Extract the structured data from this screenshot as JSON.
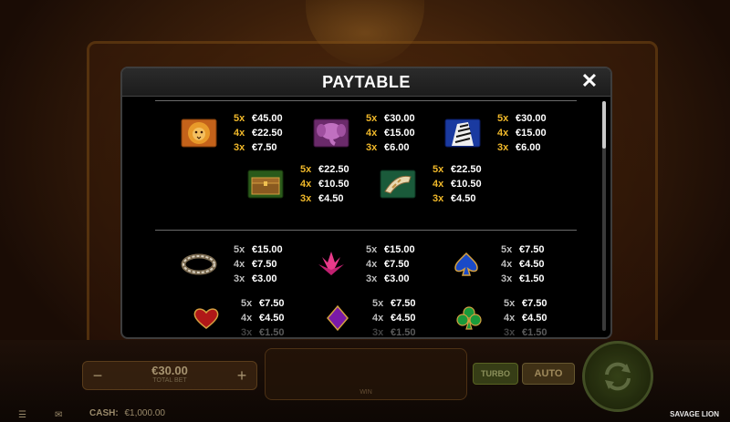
{
  "modal": {
    "title": "PAYTABLE",
    "close_icon": "close-icon"
  },
  "premium_symbols": [
    {
      "icon": "lion-icon",
      "pays": [
        {
          "count": "5x",
          "amount": "€45.00"
        },
        {
          "count": "4x",
          "amount": "€22.50"
        },
        {
          "count": "3x",
          "amount": "€7.50"
        }
      ]
    },
    {
      "icon": "elephant-icon",
      "pays": [
        {
          "count": "5x",
          "amount": "€30.00"
        },
        {
          "count": "4x",
          "amount": "€15.00"
        },
        {
          "count": "3x",
          "amount": "€6.00"
        }
      ]
    },
    {
      "icon": "zebra-icon",
      "pays": [
        {
          "count": "5x",
          "amount": "€30.00"
        },
        {
          "count": "4x",
          "amount": "€15.00"
        },
        {
          "count": "3x",
          "amount": "€6.00"
        }
      ]
    },
    {
      "icon": "treasure-chest-icon",
      "pays": [
        {
          "count": "5x",
          "amount": "€22.50"
        },
        {
          "count": "4x",
          "amount": "€10.50"
        },
        {
          "count": "3x",
          "amount": "€4.50"
        }
      ]
    },
    {
      "icon": "horn-icon",
      "pays": [
        {
          "count": "5x",
          "amount": "€22.50"
        },
        {
          "count": "4x",
          "amount": "€10.50"
        },
        {
          "count": "3x",
          "amount": "€4.50"
        }
      ]
    }
  ],
  "low_symbols": [
    {
      "icon": "bracelet-icon",
      "pays": [
        {
          "count": "5x",
          "amount": "€15.00"
        },
        {
          "count": "4x",
          "amount": "€7.50"
        },
        {
          "count": "3x",
          "amount": "€3.00"
        }
      ]
    },
    {
      "icon": "protea-flower-icon",
      "pays": [
        {
          "count": "5x",
          "amount": "€15.00"
        },
        {
          "count": "4x",
          "amount": "€7.50"
        },
        {
          "count": "3x",
          "amount": "€3.00"
        }
      ]
    },
    {
      "icon": "spade-icon",
      "pays": [
        {
          "count": "5x",
          "amount": "€7.50"
        },
        {
          "count": "4x",
          "amount": "€4.50"
        },
        {
          "count": "3x",
          "amount": "€1.50"
        }
      ]
    },
    {
      "icon": "heart-icon",
      "pays": [
        {
          "count": "5x",
          "amount": "€7.50"
        },
        {
          "count": "4x",
          "amount": "€4.50"
        },
        {
          "count": "3x",
          "amount": "€1.50"
        }
      ]
    },
    {
      "icon": "diamond-icon",
      "pays": [
        {
          "count": "5x",
          "amount": "€7.50"
        },
        {
          "count": "4x",
          "amount": "€4.50"
        },
        {
          "count": "3x",
          "amount": "€1.50"
        }
      ]
    },
    {
      "icon": "club-icon",
      "pays": [
        {
          "count": "5x",
          "amount": "€7.50"
        },
        {
          "count": "4x",
          "amount": "€4.50"
        },
        {
          "count": "3x",
          "amount": "€1.50"
        }
      ]
    }
  ],
  "controls": {
    "total_bet_value": "€30.00",
    "total_bet_label": "TOTAL BET",
    "minus_label": "−",
    "plus_label": "+",
    "win_label": "WIN",
    "turbo_label": "TURBO",
    "auto_label": "AUTO",
    "spin_icon": "spin-icon",
    "cash_label": "CASH:",
    "cash_value": "€1,000.00",
    "game_title": "SAVAGE LION"
  }
}
